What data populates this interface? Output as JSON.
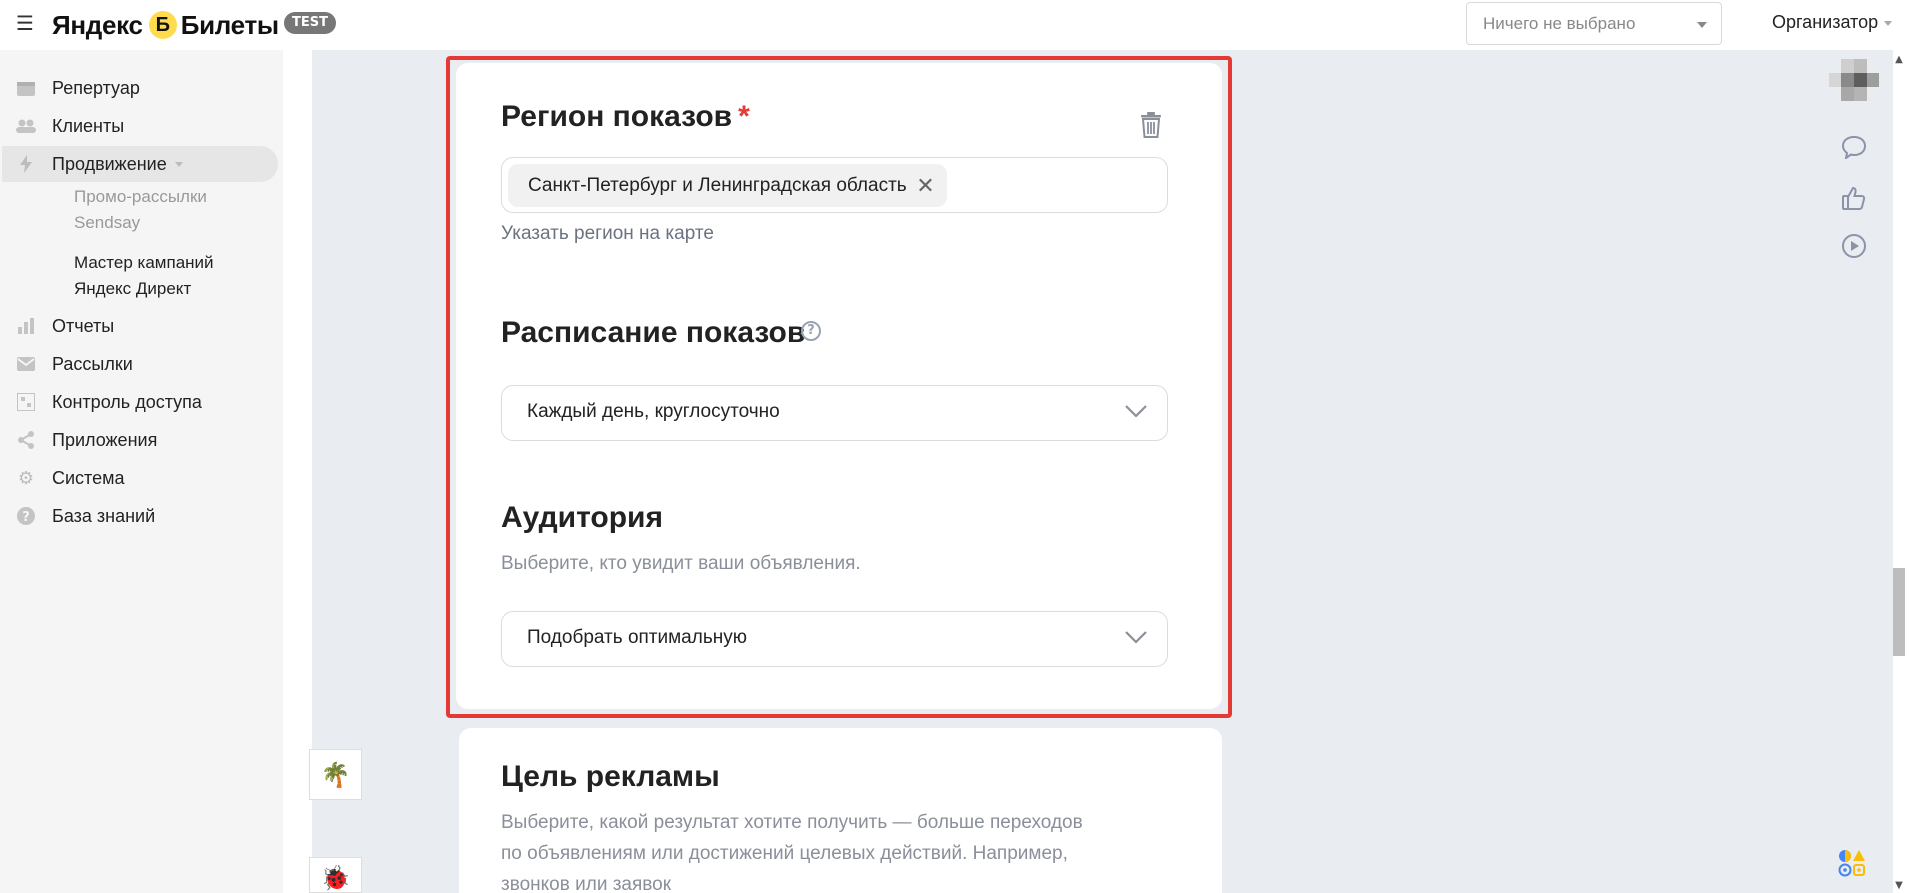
{
  "header": {
    "menu_icon": "hamburger-icon",
    "logo_left": "Яндекс",
    "logo_mark": "Б",
    "logo_right": "Билеты",
    "badge": "TEST",
    "org_select": {
      "value": "Ничего не выбрано"
    },
    "role": "Организатор"
  },
  "sidebar": {
    "items": [
      {
        "label": "Репертуар",
        "icon": "calendar-icon"
      },
      {
        "label": "Клиенты",
        "icon": "users-icon"
      },
      {
        "label": "Продвижение",
        "icon": "bolt-icon",
        "active": true
      },
      {
        "label": "Отчеты",
        "icon": "bar-chart-icon"
      },
      {
        "label": "Рассылки",
        "icon": "mail-icon"
      },
      {
        "label": "Контроль доступа",
        "icon": "qr-icon"
      },
      {
        "label": "Приложения",
        "icon": "share-icon"
      },
      {
        "label": "Система",
        "icon": "gear-icon"
      },
      {
        "label": "База знаний",
        "icon": "help-icon"
      }
    ],
    "subitems": [
      {
        "label": "Промо-рассылки Sendsay"
      },
      {
        "label": "Мастер кампаний Яндекс Директ"
      }
    ]
  },
  "region": {
    "title": "Регион показов",
    "required_mark": "*",
    "chip": "Санкт-Петербург и Ленинградская область",
    "map_link": "Указать регион на карте"
  },
  "schedule": {
    "title": "Расписание показов",
    "value": "Каждый день, круглосуточно"
  },
  "audience": {
    "title": "Аудитория",
    "hint": "Выберите, кто увидит ваши объявления.",
    "value": "Подобрать оптимальную"
  },
  "goal": {
    "title": "Цель рекламы",
    "hint_line1": "Выберите, какой результат хотите получить — больше переходов",
    "hint_line2": "по объявлениям или достижений целевых действий. Например,",
    "hint_line3": "звонков или заявок"
  },
  "colors": {
    "accent_red": "#e53935",
    "logo_yellow": "#ffdb4d",
    "main_bg": "#e9ecf1"
  }
}
